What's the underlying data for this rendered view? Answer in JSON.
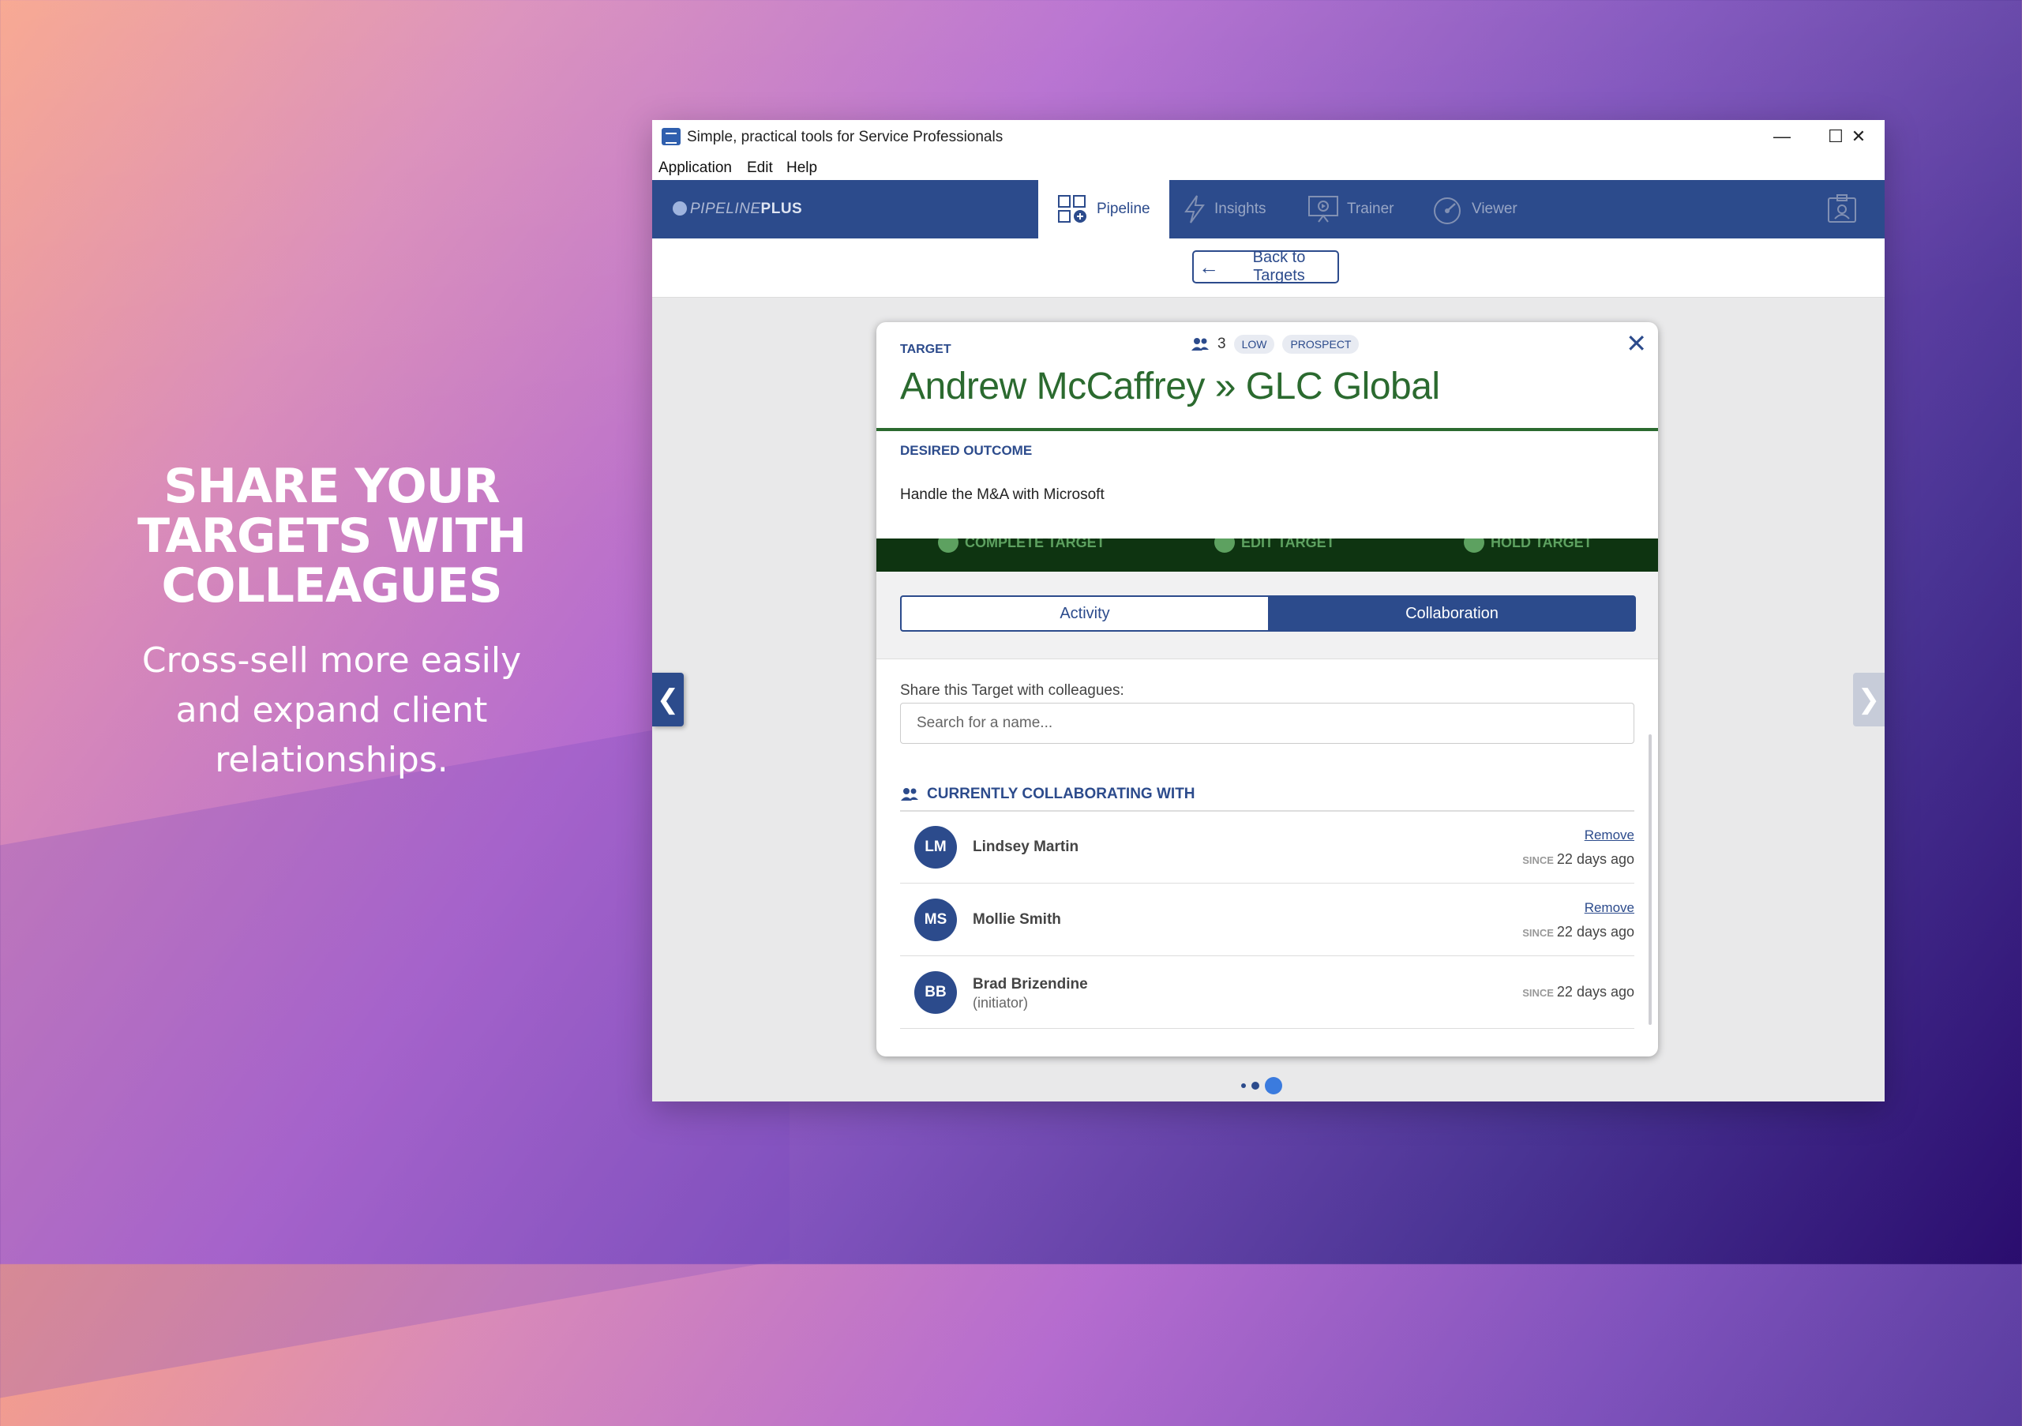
{
  "promo": {
    "title": "SHARE YOUR TARGETS WITH COLLEAGUES",
    "subtitle": "Cross-sell more easily and expand client relationships."
  },
  "window": {
    "title": "Simple, practical tools for Service Professionals",
    "controls": {
      "minimize": "—",
      "maximize": "☐",
      "close": "✕"
    }
  },
  "menu": [
    "Application",
    "Edit",
    "Help"
  ],
  "brand": {
    "light": "PIPELINE",
    "bold": "PLUS"
  },
  "nav": {
    "tabs": [
      {
        "label": "Pipeline",
        "icon": "pipeline-icon",
        "active": true
      },
      {
        "label": "Insights",
        "icon": "lightning-icon"
      },
      {
        "label": "Trainer",
        "icon": "presentation-icon"
      },
      {
        "label": "Viewer",
        "icon": "gauge-icon"
      }
    ]
  },
  "back_button": "Back to Targets",
  "card": {
    "label": "TARGET",
    "collaborator_count": "3",
    "badges": [
      "LOW",
      "PROSPECT"
    ],
    "name": "Andrew McCaffrey » GLC Global",
    "desired_outcome_label": "DESIRED OUTCOME",
    "desired_outcome": "Handle the M&A with Microsoft",
    "actions": [
      "COMPLETE TARGET",
      "EDIT TARGET",
      "HOLD TARGET"
    ],
    "tabs": {
      "activity": "Activity",
      "collaboration": "Collaboration"
    },
    "share_label": "Share this Target with colleagues:",
    "search_placeholder": "Search for a name...",
    "collab_heading": "CURRENTLY COLLABORATING WITH",
    "since_label": "SINCE",
    "remove_label": "Remove",
    "collaborators": [
      {
        "initials": "LM",
        "name": "Lindsey Martin",
        "role": "",
        "since": "22 days ago",
        "removable": true
      },
      {
        "initials": "MS",
        "name": "Mollie Smith",
        "role": "",
        "since": "22 days ago",
        "removable": true
      },
      {
        "initials": "BB",
        "name": "Brad Brizendine",
        "role": "(initiator)",
        "since": "22 days ago",
        "removable": false
      }
    ]
  },
  "colors": {
    "primary": "#2c4b8c",
    "green": "#2b6a2f",
    "action_bar": "#0e3411"
  }
}
